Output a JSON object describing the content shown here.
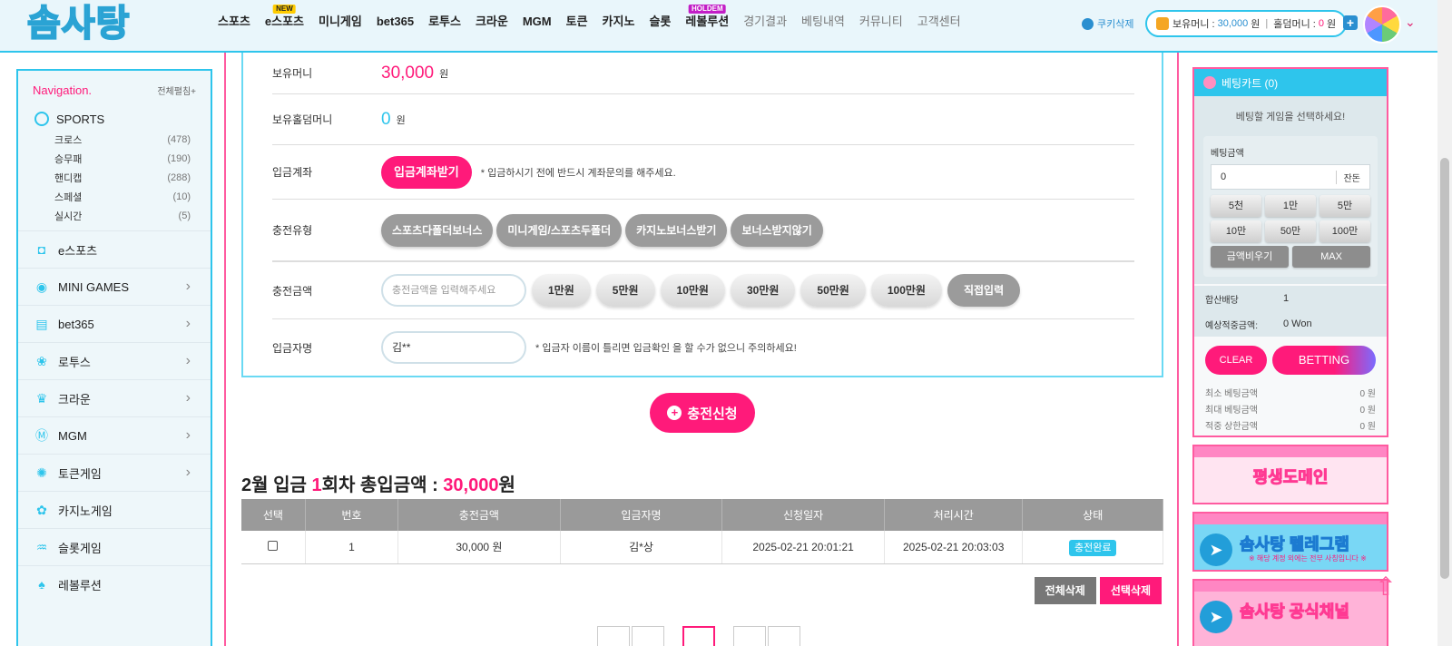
{
  "header": {
    "logo_text": "솜사탕",
    "nav": [
      {
        "label": "스포츠",
        "tag": "",
        "dim": false
      },
      {
        "label": "e스포츠",
        "tag": "NEW",
        "dim": false
      },
      {
        "label": "미니게임",
        "tag": "",
        "dim": false
      },
      {
        "label": "bet365",
        "tag": "",
        "dim": false
      },
      {
        "label": "로투스",
        "tag": "",
        "dim": false
      },
      {
        "label": "크라운",
        "tag": "",
        "dim": false
      },
      {
        "label": "MGM",
        "tag": "",
        "dim": false
      },
      {
        "label": "토큰",
        "tag": "",
        "dim": false
      },
      {
        "label": "카지노",
        "tag": "",
        "dim": false
      },
      {
        "label": "슬롯",
        "tag": "",
        "dim": false
      },
      {
        "label": "레볼루션",
        "tag": "HOLDEM",
        "dim": false
      },
      {
        "label": "경기결과",
        "tag": "",
        "dim": true
      },
      {
        "label": "베팅내역",
        "tag": "",
        "dim": true
      },
      {
        "label": "커뮤니티",
        "tag": "",
        "dim": true
      },
      {
        "label": "고객센터",
        "tag": "",
        "dim": true
      }
    ],
    "cookie_label": "쿠키삭제",
    "wallet": {
      "money_label": "보유머니 :",
      "money_value": "30,000",
      "money_unit": "원",
      "holdem_label": "홀덤머니 :",
      "holdem_value": "0",
      "holdem_unit": "원"
    },
    "plus_symbol": "+",
    "chevron_symbol": "⌄"
  },
  "sidebar": {
    "title": "Navigation.",
    "expand_label": "전체펼침+",
    "sports_label": "SPORTS",
    "sports_sub": [
      {
        "label": "크로스",
        "count": "(478)"
      },
      {
        "label": "승무패",
        "count": "(190)"
      },
      {
        "label": "핸디캡",
        "count": "(288)"
      },
      {
        "label": "스페셜",
        "count": "(10)"
      },
      {
        "label": "실시간",
        "count": "(5)"
      }
    ],
    "items": [
      {
        "label": "e스포츠",
        "icon": "mouse-icon",
        "glyph": "◘",
        "chevron": false
      },
      {
        "label": "MINI GAMES",
        "icon": "minigame-icon",
        "glyph": "◉",
        "chevron": true
      },
      {
        "label": "bet365",
        "icon": "bet365-icon",
        "glyph": "▤",
        "chevron": true
      },
      {
        "label": "로투스",
        "icon": "lotus-icon",
        "glyph": "❀",
        "chevron": true
      },
      {
        "label": "크라운",
        "icon": "crown-icon",
        "glyph": "♛",
        "chevron": true
      },
      {
        "label": "MGM",
        "icon": "mgm-icon",
        "glyph": "Ⓜ",
        "chevron": true
      },
      {
        "label": "토큰게임",
        "icon": "token-icon",
        "glyph": "✺",
        "chevron": true
      },
      {
        "label": "카지노게임",
        "icon": "casino-icon",
        "glyph": "✿",
        "chevron": false
      },
      {
        "label": "슬롯게임",
        "icon": "slot-icon",
        "glyph": "♒",
        "chevron": false
      },
      {
        "label": "레볼루션",
        "icon": "revolution-icon",
        "glyph": "♠",
        "chevron": false
      }
    ]
  },
  "form": {
    "money_label": "보유머니",
    "money_value": "30,000",
    "money_unit": "원",
    "holdem_label": "보유홀덤머니",
    "holdem_value": "0",
    "holdem_unit": "원",
    "account_label": "입금계좌",
    "account_button": "입금계좌받기",
    "account_note": "* 입금하시기 전에 반드시 계좌문의를 해주세요.",
    "type_label": "충전유형",
    "types": [
      "스포츠다폴더보너스",
      "미니게임/스포츠두폴더",
      "카지노보너스받기",
      "보너스받지않기"
    ],
    "amount_label": "충전금액",
    "amount_placeholder": "충전금액을 입력해주세요",
    "amounts": [
      "1만원",
      "5만원",
      "10만원",
      "30만원",
      "50만원",
      "100만원"
    ],
    "direct_input": "직접입력",
    "depositor_label": "입금자명",
    "depositor_value": "김**",
    "depositor_note": "* 입금자 이름이 틀리면 입금확인 을 할 수가 없으니 주의하세요!",
    "submit_label": "충전신청"
  },
  "summary": {
    "prefix": "2월 입금 ",
    "count": "1",
    "middle": "회차 총입금액 : ",
    "amount": "30,000",
    "suffix": "원"
  },
  "table": {
    "headers": [
      "선택",
      "번호",
      "충전금액",
      "입금자명",
      "신청일자",
      "처리시간",
      "상태"
    ],
    "rows": [
      {
        "no": "1",
        "amount": "30,000 원",
        "name": "김*상",
        "requested": "2025-02-21 20:01:21",
        "processed": "2025-02-21 20:03:03",
        "status": "충전완료"
      }
    ],
    "delete_all": "전체삭제",
    "delete_selected": "선택삭제"
  },
  "cart": {
    "title": "베팅카트 (0)",
    "message": "베팅할 게임을 선택하세요!",
    "amount_label": "베팅금액",
    "amount_value": "0",
    "balance_label": "잔돈",
    "quick": [
      "5천",
      "1만",
      "5만",
      "10만",
      "50만",
      "100만"
    ],
    "clear_amount": "금액비우기",
    "max": "MAX",
    "odds_label": "합산배당",
    "odds_value": "1",
    "expected_label": "예상적중금액:",
    "expected_value": "0 Won",
    "clear_btn": "CLEAR",
    "bet_btn": "BETTING",
    "limits": [
      {
        "label": "최소 베팅금액",
        "value": "0 원"
      },
      {
        "label": "최대 베팅금액",
        "value": "0 원"
      },
      {
        "label": "적중 상한금액",
        "value": "0 원"
      }
    ]
  },
  "banners": {
    "domain": "평생도메인",
    "telegram": "솜사탕 텔레그램",
    "telegram_sub": "※ 해당 계정 외에는 전부 사칭입니다 ※",
    "channel": "솜사탕 공식채널"
  },
  "colors": {
    "accent_pink": "#ff1a7a",
    "accent_cyan": "#2ec5ec",
    "header_bg": "#e9f6fb"
  }
}
